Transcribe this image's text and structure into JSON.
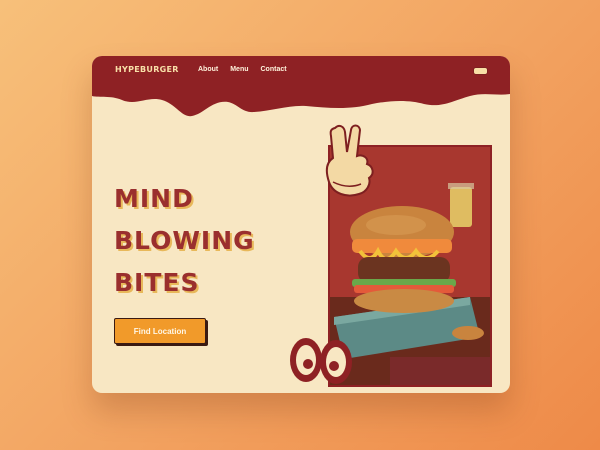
{
  "header": {
    "logo": "HYPEBURGER",
    "nav": [
      "About",
      "Menu",
      "Contact"
    ]
  },
  "hero": {
    "headline": [
      "MIND",
      "BLOWING",
      "BITES"
    ],
    "cta_label": "Find Location"
  },
  "colors": {
    "background_start": "#f7c07a",
    "background_end": "#ee8a48",
    "card": "#f8e7c3",
    "header_red": "#8e2124",
    "headline": "#9a2f2e",
    "cta": "#f19a2a"
  },
  "icons": [
    "menu-icon",
    "peace-hand-icon",
    "eyes-icon"
  ]
}
